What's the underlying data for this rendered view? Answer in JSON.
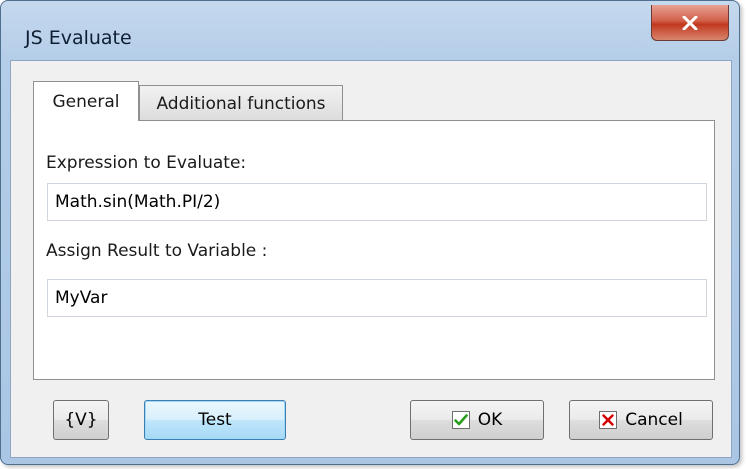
{
  "window": {
    "title": "JS Evaluate",
    "close_icon": "close-icon"
  },
  "tabs": [
    {
      "label": "General",
      "selected": true
    },
    {
      "label": "Additional functions",
      "selected": false
    }
  ],
  "form": {
    "expression_label": "Expression to Evaluate:",
    "expression_value": "Math.sin(Math.PI/2)",
    "assign_label": "Assign Result to Variable :",
    "assign_value": "MyVar"
  },
  "buttons": {
    "variables_label": "{V}",
    "test_label": "Test",
    "ok_label": "OK",
    "ok_icon": "checkmark-icon",
    "cancel_label": "Cancel",
    "cancel_icon": "cross-icon"
  },
  "colors": {
    "title_bar": "#b4cde8",
    "close_button": "#c2381e",
    "ok_icon": "#2a9d1e",
    "cancel_icon": "#d40000"
  }
}
